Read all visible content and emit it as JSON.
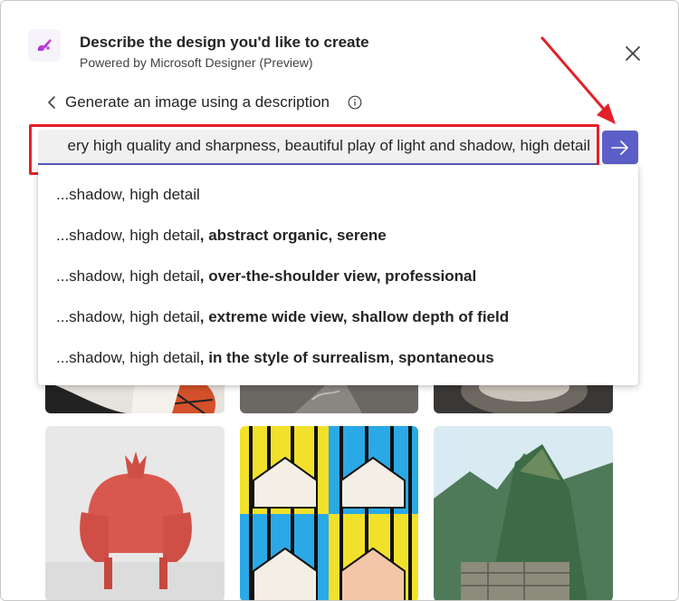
{
  "header": {
    "title": "Describe the design you'd like to create",
    "subtitle": "Powered by Microsoft Designer (Preview)",
    "logo_icon": "designer-logo-icon",
    "close_icon": "close-icon"
  },
  "section": {
    "heading": "Generate an image using a description",
    "back_icon": "chevron-left-icon",
    "info_icon": "info-icon"
  },
  "prompt": {
    "value": "ery high quality and sharpness, beautiful play of light and shadow, high detail",
    "send_icon": "arrow-right-icon"
  },
  "suggestions": [
    {
      "prefix": "...shadow, high detail",
      "suffix": ""
    },
    {
      "prefix": "...shadow, high detail",
      "suffix": ", abstract organic, serene"
    },
    {
      "prefix": "...shadow, high detail",
      "suffix": ", over-the-shoulder view, professional"
    },
    {
      "prefix": "...shadow, high detail",
      "suffix": ", extreme wide view, shallow depth of field"
    },
    {
      "prefix": "...shadow, high detail",
      "suffix": ", in the style of surrealism, spontaneous"
    }
  ],
  "colors": {
    "accent": "#5b5fc7",
    "annotation_red": "#e3202a"
  }
}
